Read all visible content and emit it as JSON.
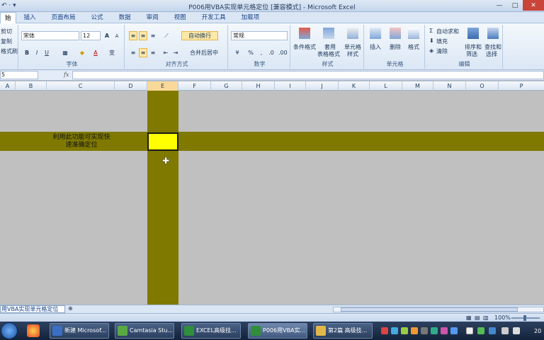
{
  "window": {
    "title": "P006用VBA实现单元格定位  [兼容模式] - Microsoft Excel",
    "qat": "↶ · ▾"
  },
  "tabs": [
    "始",
    "插入",
    "页面布局",
    "公式",
    "数据",
    "审阅",
    "视图",
    "开发工具",
    "加载项"
  ],
  "ribbon": {
    "clipboard": {
      "cut": "剪切",
      "copy": "复制",
      "format_painter": "格式刷"
    },
    "font": {
      "name": "宋体",
      "size": "12",
      "label": "字体",
      "bold": "B",
      "italic": "I",
      "underline": "U",
      "grow": "A",
      "shrink": "A",
      "color_a": "A",
      "phonetic": "变"
    },
    "alignment": {
      "wrap": "自动换行",
      "merge": "合并后居中",
      "label": "对齐方式"
    },
    "number": {
      "format": "常规",
      "percent": "%",
      "comma": ",",
      "label": "数字"
    },
    "styles": {
      "cond": "条件格式",
      "table1": "套用",
      "table2": "表格格式",
      "cell1": "单元格",
      "cell2": "样式",
      "label": "样式"
    },
    "cells": {
      "insert": "插入",
      "delete": "删除",
      "format": "格式",
      "label": "单元格"
    },
    "editing": {
      "autosum": "自动求和",
      "fill": "填充",
      "clear": "清除",
      "sort1": "排序和",
      "sort2": "筛选",
      "find1": "查找和",
      "find2": "选择",
      "label": "编辑"
    }
  },
  "formula_bar": {
    "name_box": "5",
    "fx": "fx",
    "value": ""
  },
  "columns": [
    "A",
    "B",
    "C",
    "D",
    "E",
    "F",
    "G",
    "H",
    "I",
    "J",
    "K",
    "L",
    "M",
    "N",
    "O",
    "P"
  ],
  "active_column": "E",
  "cell_text": {
    "line1": "利用此功能可实现快",
    "line2": "速准确定位"
  },
  "colors": {
    "band": "#7f7900",
    "active_cell": "#ffff00",
    "sheet_bg": "#c0c0c0"
  },
  "sheet_tab": {
    "label": "用VBA实现单元格定位"
  },
  "status": {
    "zoom": "100%"
  },
  "taskbar": {
    "tasks": [
      "新建 Microsof...",
      "Camtasia Stu...",
      "EXCEL高级技...",
      "P006用VBA实...",
      "第2篇 高级技..."
    ],
    "clock": "20"
  }
}
